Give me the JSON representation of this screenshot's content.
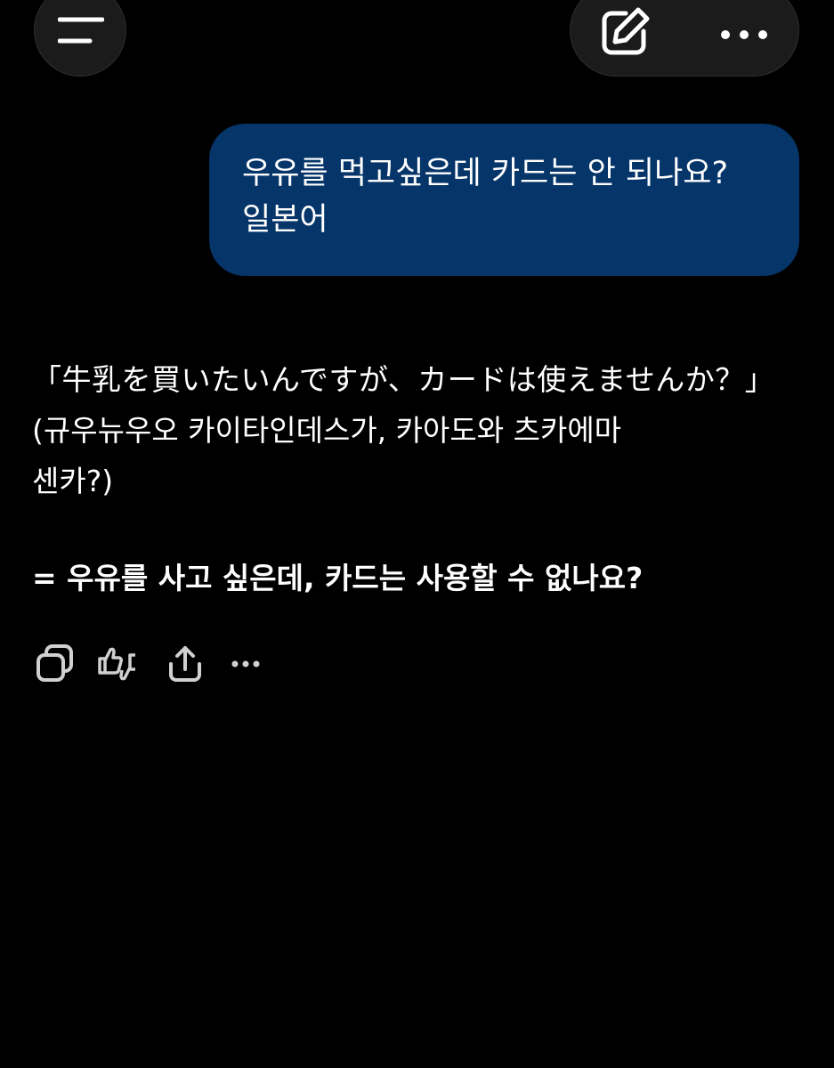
{
  "header": {
    "menu_icon": "hamburger-menu-icon",
    "edit_icon": "edit-pencil-icon",
    "more_icon": "more-horizontal-icon"
  },
  "user_message": {
    "text": "우유를 먹고싶은데 카드는 안 되나요?\n일본어",
    "bubble_color": "#063569"
  },
  "assistant_message": {
    "japanese": "「牛乳を買いたいんですが、カードは使えませんか？」",
    "pronunciation_line1": "(규우뉴우오 카이타인데스가, 카아도와 츠카에마",
    "pronunciation_line2": "센카?)",
    "meaning": "= 우유를 사고 싶은데, 카드는 사용할 수 없나요?"
  },
  "actions": {
    "copy_icon": "copy-icon",
    "feedback_icon": "thumbs-feedback-icon",
    "share_icon": "share-icon",
    "more_icon": "more-horizontal-icon"
  },
  "colors": {
    "background": "#000000",
    "button_bg": "#1b1b1b",
    "text": "#ffffff",
    "icon": "#d0d0d0"
  }
}
